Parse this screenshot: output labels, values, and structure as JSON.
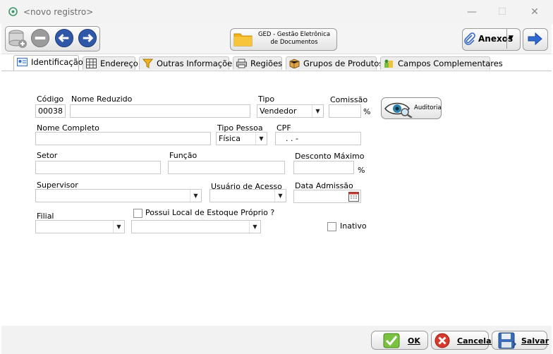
{
  "window": {
    "title": "<novo registro>"
  },
  "toolbar": {
    "ged_label": "GED - Gestão Eletrônica de Documentos",
    "anexos_label": "Anexos"
  },
  "tabs": [
    {
      "label": "Identificação",
      "icon": "id-card-icon"
    },
    {
      "label": "Endereço",
      "icon": "address-grid-icon"
    },
    {
      "label": "Outras Informações",
      "icon": "funnel-icon"
    },
    {
      "label": "Regiões",
      "icon": "printer-icon"
    },
    {
      "label": "Grupos de Produtos",
      "icon": "box-icon"
    },
    {
      "label": "Campos Complementares",
      "icon": "fields-icon"
    }
  ],
  "form": {
    "codigo_label": "Código",
    "codigo_value": "00038",
    "nome_reduzido_label": "Nome Reduzido",
    "nome_reduzido_value": "",
    "tipo_label": "Tipo",
    "tipo_value": "Vendedor",
    "comissao_label": "Comissão",
    "comissao_value": "",
    "comissao_unit": "%",
    "auditoria_label": "Auditoria",
    "nome_completo_label": "Nome Completo",
    "nome_completo_value": "",
    "tipo_pessoa_label": "Tipo Pessoa",
    "tipo_pessoa_value": "Física",
    "cpf_label": "CPF",
    "cpf_value": ".   .   -",
    "setor_label": "Setor",
    "setor_value": "",
    "funcao_label": "Função",
    "funcao_value": "",
    "desconto_label": "Desconto Máximo",
    "desconto_value": "",
    "desconto_unit": "%",
    "supervisor_label": "Supervisor",
    "supervisor_value": "",
    "usuario_label": "Usuário de Acesso",
    "usuario_value": "",
    "data_admissao_label": "Data Admissão",
    "data_admissao_value": "",
    "filial_label": "Filial",
    "filial_value": "",
    "estoque_label": "Possui Local de Estoque Próprio ?",
    "estoque_value": "",
    "inativo_label": "Inativo"
  },
  "footer": {
    "ok_label": "OK",
    "cancelar_label": "Cancelar",
    "salvar_label": "Salvar"
  }
}
